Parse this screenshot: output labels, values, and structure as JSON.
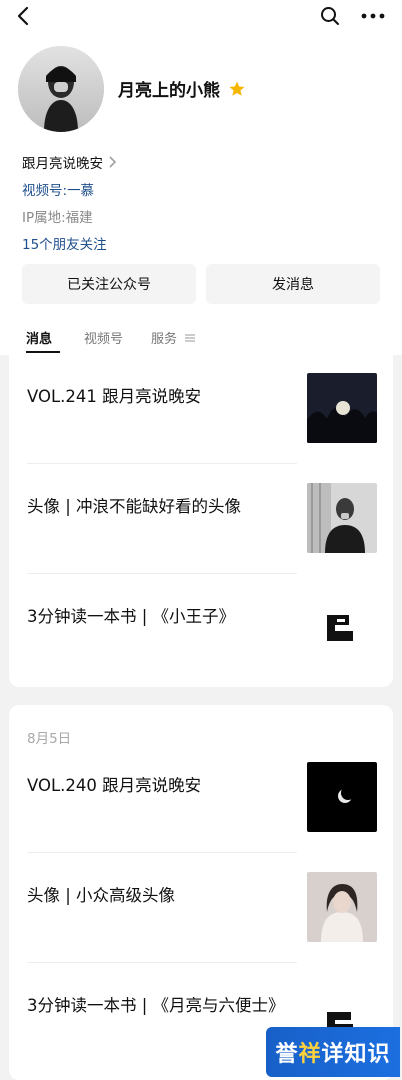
{
  "header": {
    "back_icon": "chevron-left-icon",
    "search_icon": "search-icon",
    "more_icon": "more-horizontal-icon"
  },
  "profile": {
    "name": "月亮上的小熊",
    "badge_icon": "star-icon",
    "badge_color": "#F5B700",
    "line1": "跟月亮说晚安",
    "channel_label": "视频号: ",
    "channel_value": "一慕",
    "ip_label": "IP属地: ",
    "ip_value": "福建",
    "friends_follow": "15个朋友关注",
    "buttons": {
      "followed": "已关注公众号",
      "message": "发消息"
    }
  },
  "tabs": [
    {
      "label": "消息",
      "active": true
    },
    {
      "label": "视频号",
      "active": false
    },
    {
      "label": "服务",
      "active": false
    }
  ],
  "feed": {
    "card1": [
      {
        "title": "VOL.241 跟月亮说晚安"
      },
      {
        "title": "头像 | 冲浪不能缺好看的头像"
      },
      {
        "title": "3分钟读一本书 | 《小王子》"
      }
    ],
    "card2_date": "8月5日",
    "card2": [
      {
        "title": "VOL.240 跟月亮说晚安"
      },
      {
        "title": "头像 | 小众高级头像"
      },
      {
        "title": "3分钟读一本书 | 《月亮与六便士》"
      }
    ]
  },
  "watermark": {
    "text1": "誉",
    "text2": "祥",
    "text3": "详知识"
  }
}
